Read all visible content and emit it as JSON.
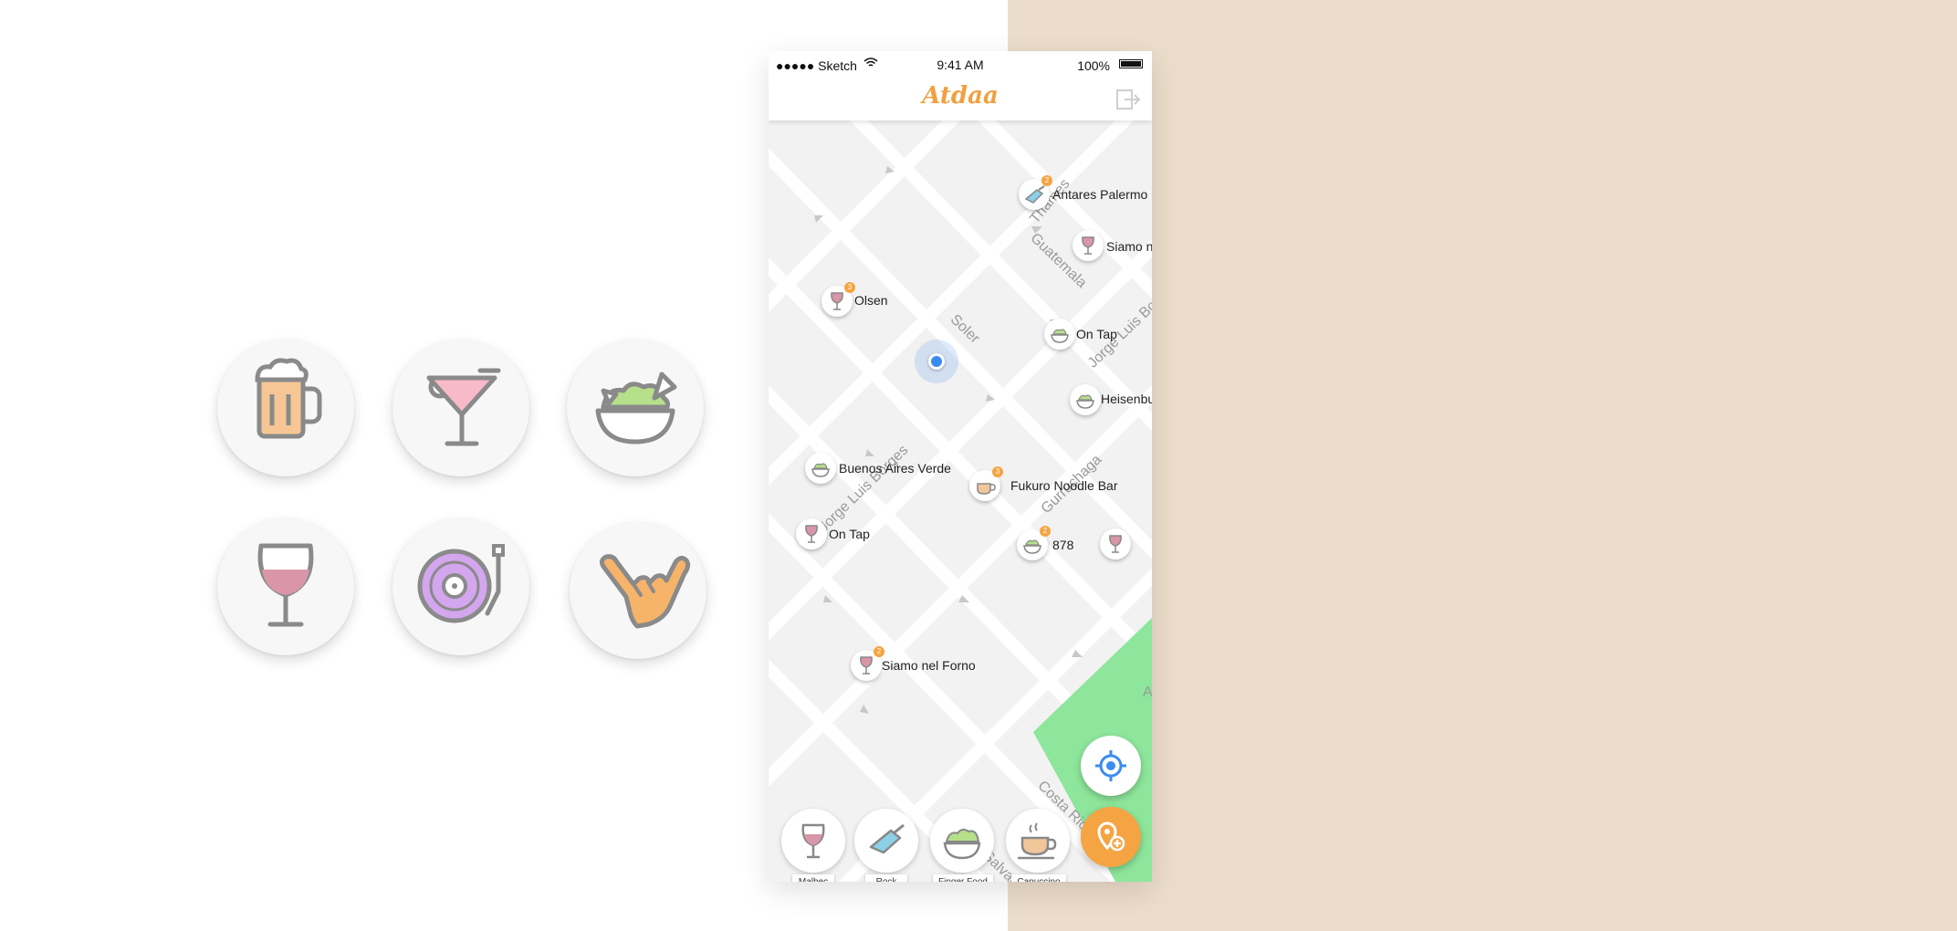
{
  "icon_grid": [
    {
      "icon": "beer-mug-icon"
    },
    {
      "icon": "cocktail-glass-icon"
    },
    {
      "icon": "finger-food-bowl-icon"
    },
    {
      "icon": "wine-glass-icon"
    },
    {
      "icon": "vinyl-record-icon"
    },
    {
      "icon": "shaka-hand-icon"
    }
  ],
  "colors": {
    "accent": "#f5a443",
    "user_dot": "#3b8cf0",
    "park": "#8de69b",
    "backdrop": "#ecdcca"
  },
  "status_bar": {
    "carrier": "●●●●● Sketch",
    "time": "9:41 AM",
    "battery": "100%"
  },
  "header": {
    "logo": "Atdaa",
    "exit_icon": "exit-icon"
  },
  "streets": [
    "Thames",
    "Guatemala",
    "Soler",
    "Jorge Luis Borges",
    "Jorge Luis Borges",
    "Gurruchaga",
    "Costa Rica",
    "El Salvador",
    "A"
  ],
  "places": [
    {
      "name": "Antares Palermo",
      "icon": "guitar-icon",
      "badge": "2"
    },
    {
      "name": "Siamo n",
      "icon": "wine-glass-icon",
      "badge": ""
    },
    {
      "name": "Olsen",
      "icon": "wine-glass-icon",
      "badge": "3"
    },
    {
      "name": "On Tap",
      "icon": "finger-food-icon",
      "badge": ""
    },
    {
      "name": "Heisenbu",
      "icon": "finger-food-icon",
      "badge": ""
    },
    {
      "name": "Buenos Aires Verde",
      "icon": "finger-food-icon",
      "badge": ""
    },
    {
      "name": "Fukuro Noodle Bar",
      "icon": "coffee-cup-icon",
      "badge": "3"
    },
    {
      "name": "On Tap",
      "icon": "wine-glass-icon",
      "badge": ""
    },
    {
      "name": "878",
      "icon": "finger-food-icon",
      "badge": "2"
    },
    {
      "name": "",
      "icon": "wine-glass-icon",
      "badge": ""
    },
    {
      "name": "Siamo nel Forno",
      "icon": "wine-glass-icon",
      "badge": "2"
    }
  ],
  "categories": [
    {
      "label": "Malbec",
      "icon": "wine-glass-icon"
    },
    {
      "label": "Rock Concert",
      "icon": "guitar-icon"
    },
    {
      "label": "Finger Food",
      "icon": "finger-food-icon"
    },
    {
      "label": "Capuccino",
      "icon": "coffee-cup-icon"
    }
  ],
  "actions": {
    "locate_icon": "locate-icon",
    "add_place_icon": "add-place-icon"
  }
}
